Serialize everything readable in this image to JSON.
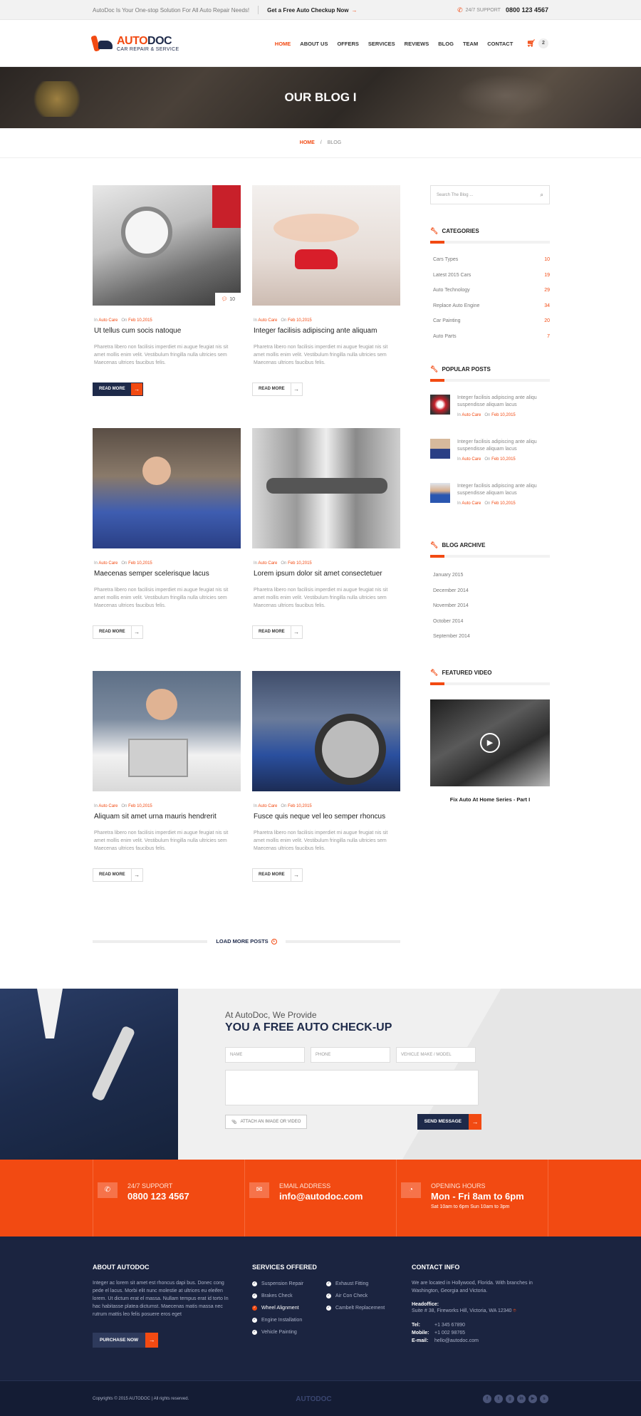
{
  "topbar": {
    "tagline": "AutoDoc Is Your One-stop Solution For All Auto Repair Needs!",
    "cta": "Get a Free Auto Checkup Now",
    "support_label": "24/7 SUPPORT",
    "support_phone": "0800 123 4567"
  },
  "logo": {
    "word_a": "AUTO",
    "word_b": "DOC",
    "tagline": "CAR REPAIR & SERVICE"
  },
  "nav": [
    "HOME",
    "ABOUT US",
    "OFFERS",
    "SERVICES",
    "REVIEWS",
    "BLOG",
    "TEAM",
    "CONTACT"
  ],
  "cart_count": "2",
  "banner_title": "OUR BLOG I",
  "breadcrumb": {
    "home": "HOME",
    "sep": "/",
    "current": "BLOG"
  },
  "posts": [
    {
      "in": "In",
      "cat": "Auto Care",
      "on": "On",
      "date": "Feb 10,2015",
      "title": "Ut tellus cum socis natoque",
      "excerpt": "Pharetra libero non facilisis imperdiet mi augue feugiat nis sit amet mollis enim velit. Vestibulum fringilla nulla ultricies sem Maecenas ultrices faucibus felis.",
      "more": "READ MORE",
      "comments": "10"
    },
    {
      "in": "In",
      "cat": "Auto Care",
      "on": "On",
      "date": "Feb 10,2015",
      "title": "Integer facilisis adipiscing ante aliquam",
      "excerpt": "Pharetra libero non facilisis imperdiet mi augue feugiat nis sit amet mollis enim velit. Vestibulum fringilla nulla ultricies sem Maecenas ultrices faucibus felis.",
      "more": "READ MORE"
    },
    {
      "in": "In",
      "cat": "Auto Care",
      "on": "On",
      "date": "Feb 10,2015",
      "title": "Maecenas semper scelerisque lacus",
      "excerpt": "Pharetra libero non facilisis imperdiet mi augue feugiat nis sit amet mollis enim velit. Vestibulum fringilla nulla ultricies sem Maecenas ultrices faucibus felis.",
      "more": "READ MORE"
    },
    {
      "in": "In",
      "cat": "Auto Care",
      "on": "On",
      "date": "Feb 10,2015",
      "title": "Lorem ipsum dolor sit amet consectetuer",
      "excerpt": "Pharetra libero non facilisis imperdiet mi augue feugiat nis sit amet mollis enim velit. Vestibulum fringilla nulla ultricies sem Maecenas ultrices faucibus felis.",
      "more": "READ MORE"
    },
    {
      "in": "In",
      "cat": "Auto Care",
      "on": "On",
      "date": "Feb 10,2015",
      "title": "Aliquam sit amet urna mauris hendrerit",
      "excerpt": "Pharetra libero non facilisis imperdiet mi augue feugiat nis sit amet mollis enim velit. Vestibulum fringilla nulla ultricies sem Maecenas ultrices faucibus felis.",
      "more": "READ MORE"
    },
    {
      "in": "In",
      "cat": "Auto Care",
      "on": "On",
      "date": "Feb 10,2015",
      "title": "Fusce quis neque vel leo semper rhoncus",
      "excerpt": "Pharetra libero non facilisis imperdiet mi augue feugiat nis sit amet mollis enim velit. Vestibulum fringilla nulla ultricies sem Maecenas ultrices faucibus felis.",
      "more": "READ MORE"
    }
  ],
  "load_more": "LOAD MORE POSTS",
  "sidebar": {
    "search_placeholder": "Search The Blog ...",
    "categories_title": "CATEGORIES",
    "categories": [
      {
        "name": "Cars Types",
        "count": "10"
      },
      {
        "name": "Latest 2015 Cars",
        "count": "19"
      },
      {
        "name": "Auto Technology",
        "count": "29"
      },
      {
        "name": "Replace Auto Engine",
        "count": "34"
      },
      {
        "name": "Car Painting",
        "count": "20"
      },
      {
        "name": "Auto Parts",
        "count": "7"
      }
    ],
    "popular_title": "POPULAR POSTS",
    "popular": [
      {
        "text": "Integer facilisis adipiscing ante aliqu suspendisse aliquam lacus",
        "in": "In",
        "cat": "Auto Care",
        "on": "On",
        "date": "Feb 10,2015"
      },
      {
        "text": "Integer facilisis adipiscing ante aliqu suspendisse aliquam lacus",
        "in": "In",
        "cat": "Auto Care",
        "on": "On",
        "date": "Feb 10,2015"
      },
      {
        "text": "Integer facilisis adipiscing ante aliqu suspendisse aliquam lacus",
        "in": "In",
        "cat": "Auto Care",
        "on": "On",
        "date": "Feb 10,2015"
      }
    ],
    "archive_title": "BLOG ARCHIVE",
    "archive": [
      "January 2015",
      "December 2014",
      "November 2014",
      "October 2014",
      "September 2014"
    ],
    "video_title": "FEATURED VIDEO",
    "video_caption": "Fix Auto At Home Series - Part I"
  },
  "checkup": {
    "pre": "At AutoDoc, We Provide",
    "title": "YOU A FREE AUTO CHECK-UP",
    "name_ph": "NAME",
    "phone_ph": "PHONE",
    "vehicle_ph": "VEHICLE MAKE / MODEL",
    "attach": "ATTACH AN IMAGE OR VIDEO",
    "send": "SEND MESSAGE"
  },
  "band": {
    "support_label": "24/7 SUPPORT",
    "support_value": "0800 123 4567",
    "email_label": "EMAIL ADDRESS",
    "email_value": "info@autodoc.com",
    "hours_label": "OPENING HOURS",
    "hours_value": "Mon - Fri  8am to 6pm",
    "hours_sub": "Sat 10am to 6pm    Sun 10am to 3pm"
  },
  "footer": {
    "about_title": "ABOUT AUTODOC",
    "about_text": "Integer ac lorem sit amet est rhoncus dapi bus. Donec cong pede el lacus. Morbi elit nunc molestie at ultrices eu eleifen lorem. Ut dictum erat el massa. Nullam tempus erat id torto In hac habitasse platea dictumst. Maecenas matis massa nec rutrum mattis leo felis posuere eros eget",
    "purchase": "PURCHASE NOW",
    "services_title": "SERVICES OFFERED",
    "services": [
      "Suspension Repair",
      "Exhaust Fitting",
      "Brakes Check",
      "Air Con Check",
      "Wheel Alignment",
      "Cambelt Replacement",
      "Engine Installation",
      "",
      "Vehicle Painting",
      ""
    ],
    "contact_title": "CONTACT INFO",
    "contact_text": "We are located in Hollywood, Florida. With branches in Washington, Georgia and Victoria.",
    "head_label": "Headoffice:",
    "head_addr": "Suite # 38, Fireworks Hill, Victoria, WA 12340",
    "tel_label": "Tel:",
    "tel": "+1 345 67890",
    "mobile_label": "Mobile:",
    "mobile": "+1 002 98765",
    "email_label": "E-mail:",
    "email": "hello@autodoc.com",
    "copyright": "Copyrights © 2015 AUTODOC  |  All rights reserved.",
    "logo_text": "AUTODOC"
  },
  "colors": {
    "accent": "#f24a12",
    "navy": "#1e2a4a",
    "footer": "#1b2440"
  }
}
